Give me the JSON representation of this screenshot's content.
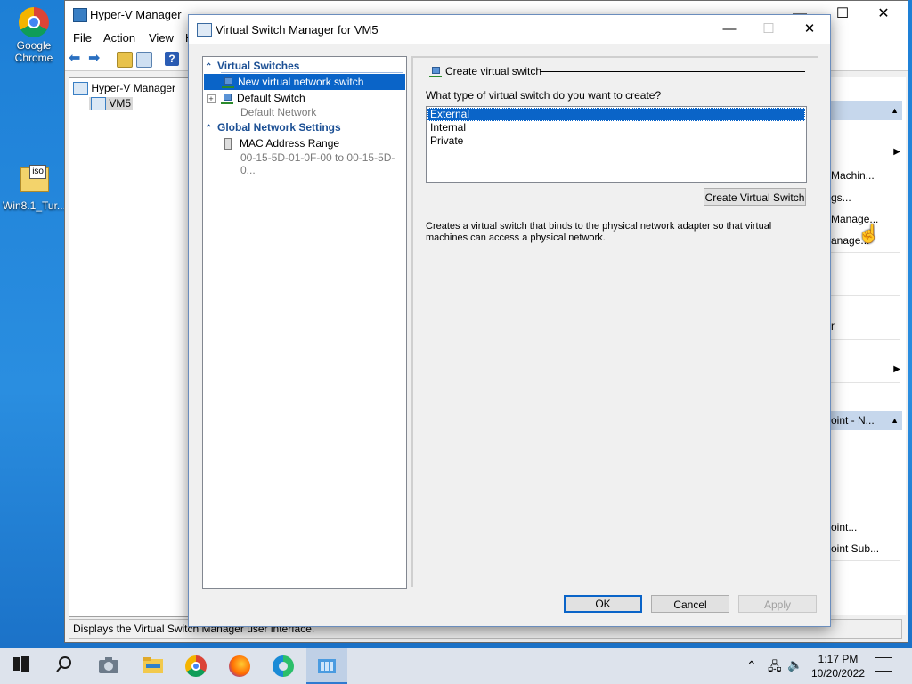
{
  "desktop": {
    "icons": [
      {
        "label_line1": "Google",
        "label_line2": "Chrome"
      },
      {
        "label_line1": "Win8.1_Tur...",
        "badge": "iso"
      }
    ]
  },
  "hyperv": {
    "title": "Hyper-V Manager",
    "menu": [
      "File",
      "Action",
      "View",
      "H"
    ],
    "tree_root": "Hyper-V Manager",
    "tree_child": "VM5",
    "actions_partial": [
      "Machin...",
      "gs...",
      "Manage...",
      "anage..."
    ],
    "actions_partial_2": [
      "r"
    ],
    "section2_header": "oint - N...",
    "actions_partial_3": [
      "oint...",
      "oint Sub..."
    ],
    "status": "Displays the Virtual Switch Manager user interface.",
    "caption": {
      "minimize": "—",
      "maximize": "☐",
      "close": "✕"
    }
  },
  "dialog": {
    "title": "Virtual Switch Manager for VM5",
    "caption": {
      "minimize": "—",
      "maximize": "☐",
      "close": "✕"
    },
    "nav": {
      "section1": "Virtual Switches",
      "new_switch": "New virtual network switch",
      "default_switch": "Default Switch",
      "default_switch_sub": "Default Network",
      "section2": "Global Network Settings",
      "mac_range": "MAC Address Range",
      "mac_range_sub": "00-15-5D-01-0F-00 to 00-15-5D-0..."
    },
    "main": {
      "group_title": "Create virtual switch",
      "question": "What type of virtual switch do you want to create?",
      "types": [
        "External",
        "Internal",
        "Private"
      ],
      "selected_type": "External",
      "create_button": "Create Virtual Switch",
      "description": "Creates a virtual switch that binds to the physical network adapter so that virtual machines can access a physical network."
    },
    "buttons": {
      "ok": "OK",
      "cancel": "Cancel",
      "apply": "Apply"
    }
  },
  "taskbar": {
    "time": "1:17 PM",
    "date": "10/20/2022"
  }
}
